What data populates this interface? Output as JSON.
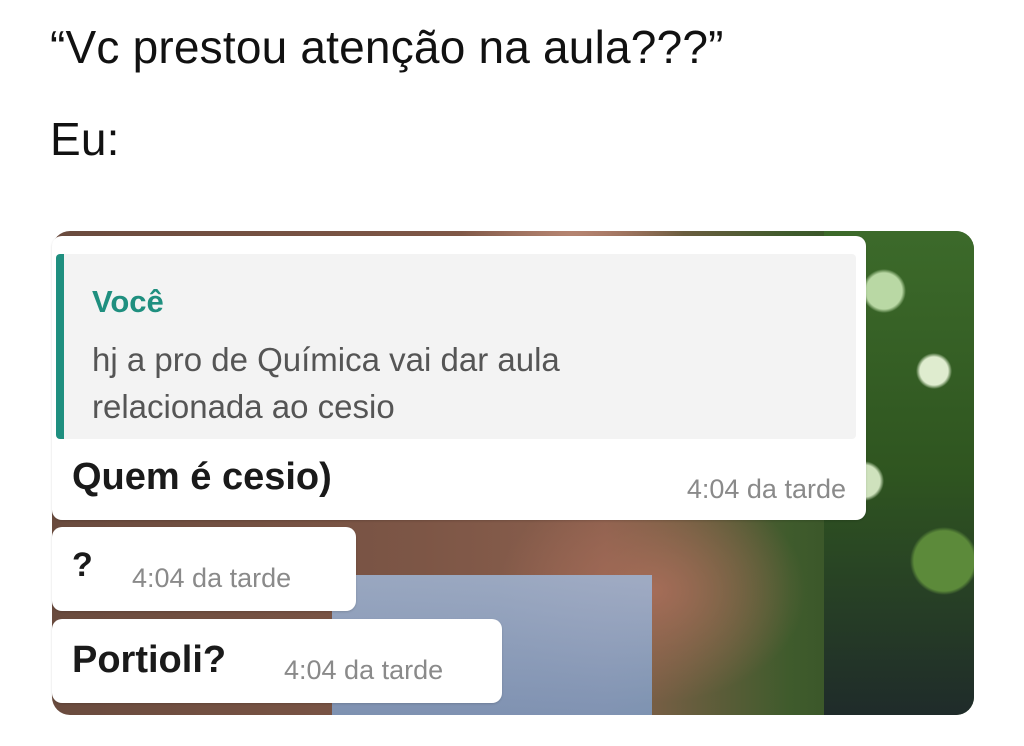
{
  "caption": {
    "line1": "“Vc prestou atenção na aula???”",
    "line2": "Eu:"
  },
  "chat": {
    "quoted": {
      "author": "Você",
      "text_line1": "hj a pro de Química vai dar aula",
      "text_line2": "relacionada ao cesio",
      "accent_color": "#1f8f7f"
    },
    "messages": [
      {
        "text": "Quem é cesio)",
        "time": "4:04 da tarde"
      },
      {
        "text": "?",
        "time": "4:04 da tarde"
      },
      {
        "text": "Portioli?",
        "time": "4:04 da tarde"
      }
    ]
  }
}
